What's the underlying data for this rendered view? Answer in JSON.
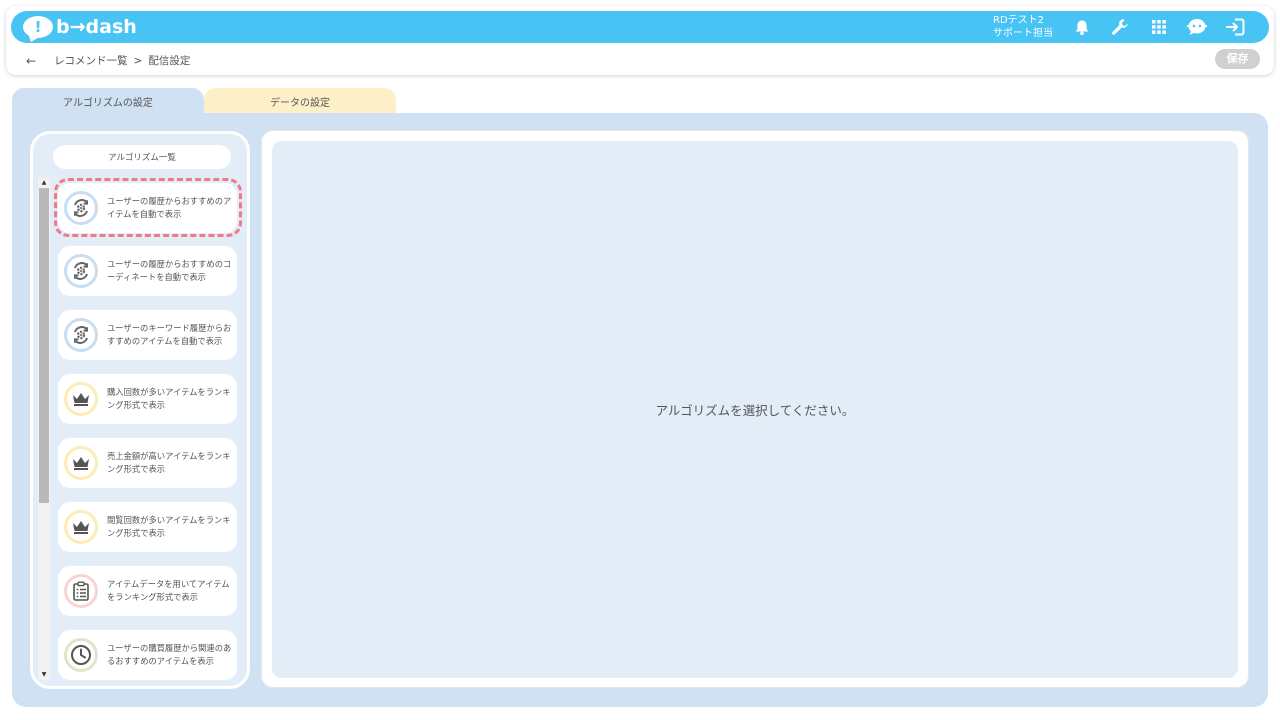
{
  "app": {
    "logo_text": "b→dash",
    "logo_mark": "!"
  },
  "user": {
    "org": "RDテスト2",
    "role": "サポート担当"
  },
  "topbar_icons": [
    "bell-icon",
    "wrench-icon",
    "grid-icon",
    "support-face-icon",
    "logout-icon"
  ],
  "breadcrumb": {
    "back": "←",
    "parent": "レコメンド一覧",
    "separator": ">",
    "current": "配信設定"
  },
  "save_label": "保存",
  "tabs": [
    {
      "label": "アルゴリズムの設定",
      "active": true
    },
    {
      "label": "データの設定",
      "active": false
    }
  ],
  "sidebar": {
    "title": "アルゴリズム一覧",
    "items": [
      {
        "label": "ユーザーの履歴からおすすめのアイテムを自動で表示",
        "icon": "auto-gear-cycle-icon",
        "ring": "#c8ddf0",
        "selected": true
      },
      {
        "label": "ユーザーの履歴からおすすめのコーディネートを自動で表示",
        "icon": "auto-gear-cycle-icon",
        "ring": "#c8ddf0",
        "selected": false
      },
      {
        "label": "ユーザーのキーワード履歴からおすすめのアイテムを自動で表示",
        "icon": "auto-gear-cycle-icon",
        "ring": "#c8ddf0",
        "selected": false
      },
      {
        "label": "購入回数が多いアイテムをランキング形式で表示",
        "icon": "crown-icon",
        "ring": "#fdebb8",
        "selected": false
      },
      {
        "label": "売上金額が高いアイテムをランキング形式で表示",
        "icon": "crown-icon",
        "ring": "#fdebb8",
        "selected": false
      },
      {
        "label": "閲覧回数が多いアイテムをランキング形式で表示",
        "icon": "crown-icon",
        "ring": "#fdebb8",
        "selected": false
      },
      {
        "label": "アイテムデータを用いてアイテムをランキング形式で表示",
        "icon": "clipboard-list-icon",
        "ring": "#f8d4d4",
        "selected": false
      },
      {
        "label": "ユーザーの購買履歴から関連のあるおすすめのアイテムを表示",
        "icon": "clock-icon",
        "ring": "#dde7c9",
        "selected": false
      }
    ]
  },
  "main": {
    "placeholder": "アルゴリズムを選択してください。"
  },
  "colors": {
    "brand": "#48c4f4",
    "panel": "#cfe1f2",
    "content_bg": "#e2edf7",
    "tab_data": "#fdf0c8",
    "highlight": "#f07a86",
    "save_disabled": "#d0d0d0"
  }
}
